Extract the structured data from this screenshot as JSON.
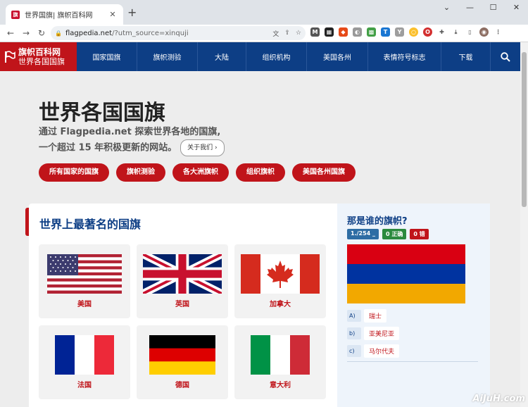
{
  "browser": {
    "tab_title": "世界国旗| 旗帜百科网",
    "tab_close": "✕",
    "new_tab": "+",
    "url_host": "flagpedia.net",
    "url_rest": "/?utm_source=xinquji",
    "window_controls": [
      "⌄",
      "—",
      "☐",
      "✕"
    ],
    "nav": {
      "back": "←",
      "forward": "→",
      "reload": "↻"
    }
  },
  "site": {
    "logo_line1": "旗帜百科网",
    "logo_line2": "世界各国国旗",
    "nav_items": [
      "国家国旗",
      "旗帜测验",
      "大陆",
      "组织机构",
      "美国各州",
      "表情符号标志",
      "下载"
    ]
  },
  "hero": {
    "title": "世界各国国旗",
    "sub_line1": "通过 Flagpedia.net 探索世界各地的国旗,",
    "sub_line2": "一个超过 15 年积极更新的网站。",
    "about_button": "关于我们 ›",
    "buttons": [
      "所有国家的国旗",
      "旗帜测验",
      "各大洲旗帜",
      "组织旗帜",
      "美国各州国旗"
    ]
  },
  "famous": {
    "heading": "世界上最著名的国旗",
    "flags": [
      {
        "name": "美国"
      },
      {
        "name": "英国"
      },
      {
        "name": "加拿大"
      },
      {
        "name": "法国"
      },
      {
        "name": "德国"
      },
      {
        "name": "意大利"
      }
    ]
  },
  "quiz": {
    "heading": "那是谁的旗帜?",
    "progress": "1./254 _",
    "correct": "0 正确",
    "wrong": "0 错",
    "options": [
      {
        "key": "A)",
        "answer": "瑞士"
      },
      {
        "key": "b)",
        "answer": "亚美尼亚"
      },
      {
        "key": "c)",
        "answer": "马尔代夫"
      }
    ],
    "colors": {
      "progress": "#2e6da4",
      "correct": "#2b8a3e",
      "wrong": "#c0141a"
    }
  },
  "watermark": "AiJuH.com"
}
